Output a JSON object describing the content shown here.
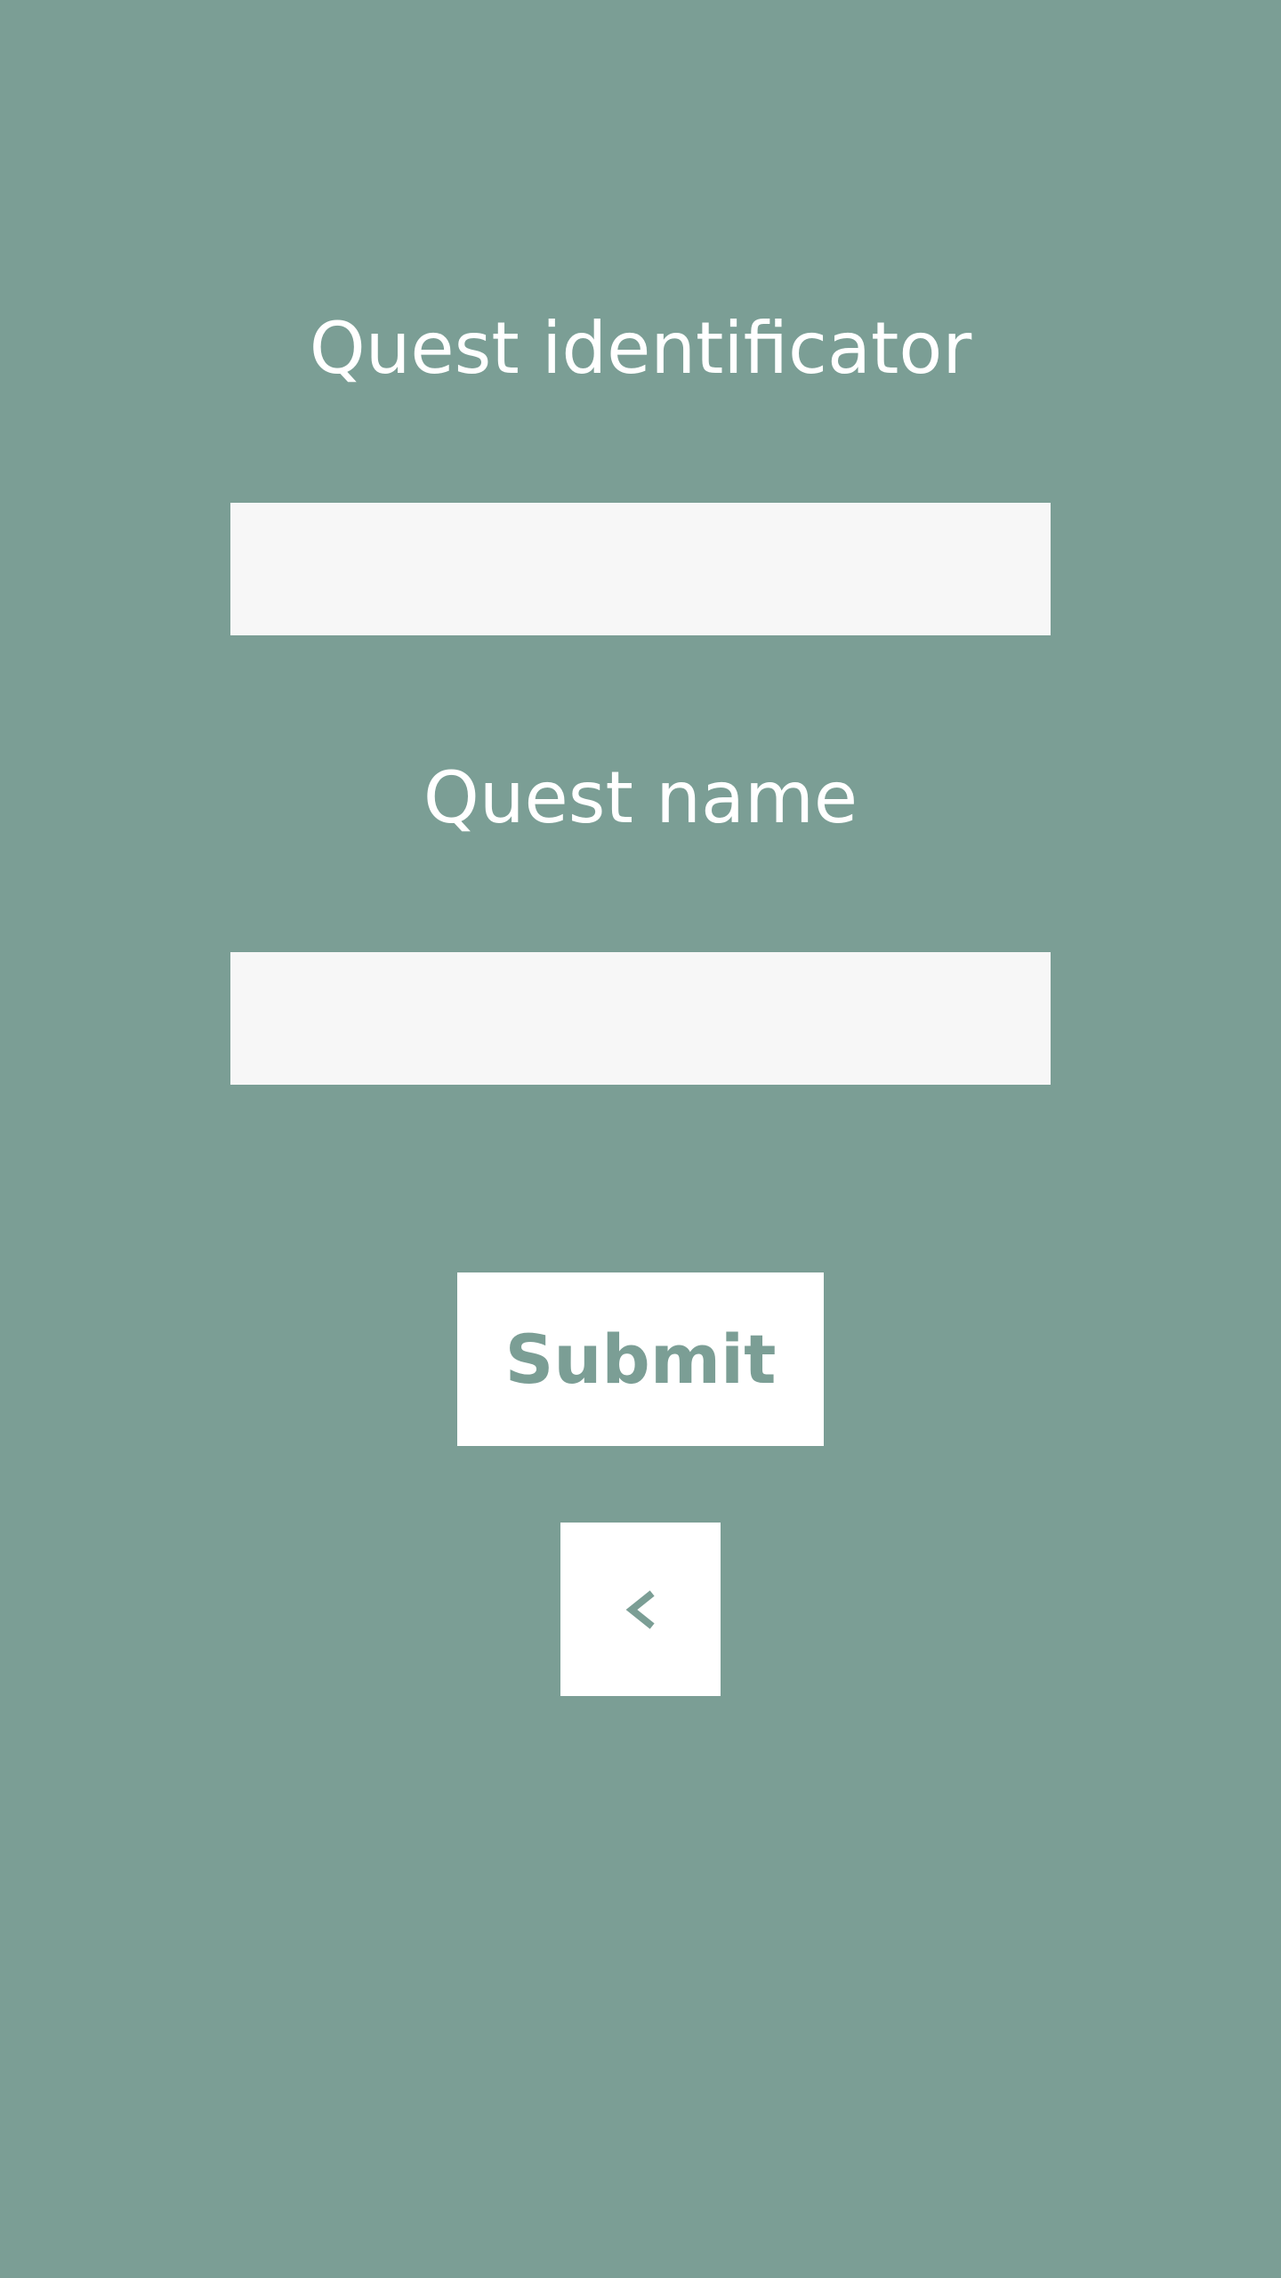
{
  "form": {
    "quest_id_label": "Quest identificator",
    "quest_id_value": "",
    "quest_name_label": "Quest name",
    "quest_name_value": ""
  },
  "actions": {
    "submit_label": "Submit",
    "back_icon": "chevron-left-icon"
  },
  "colors": {
    "background": "#7b9e95",
    "field_background": "#f7f7f7",
    "button_background": "#ffffff",
    "button_text": "#7b9e95",
    "label_text": "#ffffff"
  }
}
